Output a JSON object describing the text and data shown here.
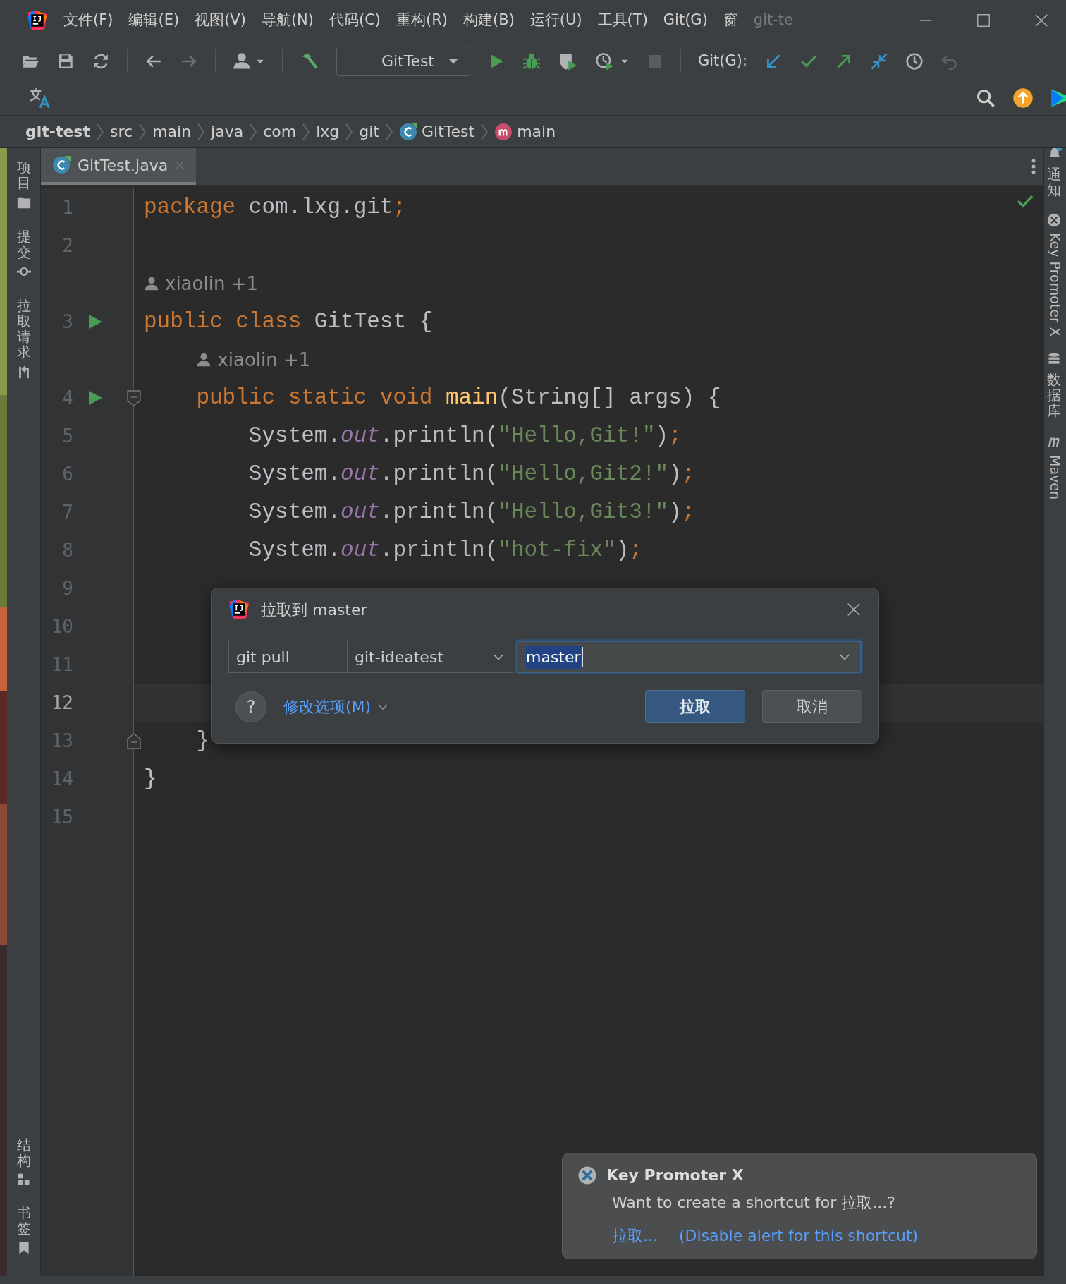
{
  "menu_bar": {
    "items": [
      "文件(F)",
      "编辑(E)",
      "视图(V)",
      "导航(N)",
      "代码(C)",
      "重构(R)",
      "构建(B)",
      "运行(U)",
      "工具(T)",
      "Git(G)",
      "窗"
    ],
    "title": "git-te"
  },
  "toolbar": {
    "run_config": "GitTest",
    "git_label": "Git(G):"
  },
  "breadcrumb": [
    {
      "label": "git-test",
      "kind": "project"
    },
    {
      "label": "src",
      "kind": "folder"
    },
    {
      "label": "main",
      "kind": "folder"
    },
    {
      "label": "java",
      "kind": "folder"
    },
    {
      "label": "com",
      "kind": "folder"
    },
    {
      "label": "lxg",
      "kind": "folder"
    },
    {
      "label": "git",
      "kind": "folder"
    },
    {
      "label": "GitTest",
      "kind": "class"
    },
    {
      "label": "main",
      "kind": "method"
    }
  ],
  "left_tool_windows": [
    {
      "label": "项目",
      "kind": "project"
    },
    {
      "label": "提交",
      "kind": "commit"
    },
    {
      "label": "拉取请求",
      "kind": "pull_request"
    }
  ],
  "left_bottom_tool_windows": [
    {
      "label": "结构",
      "kind": "structure"
    },
    {
      "label": "书签",
      "kind": "bookmarks"
    }
  ],
  "right_tool_windows": [
    {
      "label": "通知",
      "kind": "notifications"
    },
    {
      "label": "Key Promoter X",
      "kind": "key_promoter"
    },
    {
      "label": "数据库",
      "kind": "database"
    },
    {
      "label": "Maven",
      "kind": "maven"
    }
  ],
  "tabs": [
    {
      "label": "GitTest.java",
      "selected": true
    }
  ],
  "editor": {
    "lines": [
      {
        "kind": "code",
        "number": "1",
        "run": false,
        "fold_start": false,
        "fold_end": false,
        "current": false,
        "tokens": [
          {
            "kind": "kw",
            "text": "package"
          },
          {
            "kind": "plain",
            "text": " com.lxg.git"
          },
          {
            "kind": "semi",
            "text": ";"
          }
        ]
      },
      {
        "kind": "code",
        "number": "2",
        "run": false,
        "fold_start": false,
        "fold_end": false,
        "current": false
      },
      {
        "kind": "hint",
        "text": "xiaolin +1"
      },
      {
        "kind": "code",
        "number": "3",
        "run": true,
        "fold_start": false,
        "fold_end": false,
        "current": false,
        "tokens": [
          {
            "kind": "kw",
            "text": "public class"
          },
          {
            "kind": "plain",
            "text": " GitTest {"
          }
        ]
      },
      {
        "kind": "hint",
        "text": "xiaolin +1"
      },
      {
        "kind": "code",
        "number": "4",
        "run": true,
        "fold_start": true,
        "fold_end": false,
        "current": false,
        "tokens": [
          {
            "kind": "kw",
            "text": "    public static void"
          },
          {
            "kind": "fn",
            "text": " main"
          },
          {
            "kind": "plain",
            "text": "(String[] args) {"
          }
        ]
      },
      {
        "kind": "code",
        "number": "5",
        "run": false,
        "fold_start": false,
        "fold_end": false,
        "current": false,
        "tokens": [
          {
            "kind": "plain",
            "text": "        System."
          },
          {
            "kind": "field",
            "text": "out"
          },
          {
            "kind": "plain",
            "text": ".println("
          },
          {
            "kind": "str",
            "text": "\"Hello,Git!\""
          },
          {
            "kind": "plain",
            "text": ")"
          },
          {
            "kind": "semi",
            "text": ";"
          }
        ]
      },
      {
        "kind": "code",
        "number": "6",
        "run": false,
        "fold_start": false,
        "fold_end": false,
        "current": false,
        "tokens": [
          {
            "kind": "plain",
            "text": "        System."
          },
          {
            "kind": "field",
            "text": "out"
          },
          {
            "kind": "plain",
            "text": ".println("
          },
          {
            "kind": "str",
            "text": "\"Hello,Git2!\""
          },
          {
            "kind": "plain",
            "text": ")"
          },
          {
            "kind": "semi",
            "text": ";"
          }
        ]
      },
      {
        "kind": "code",
        "number": "7",
        "run": false,
        "fold_start": false,
        "fold_end": false,
        "current": false,
        "tokens": [
          {
            "kind": "plain",
            "text": "        System."
          },
          {
            "kind": "field",
            "text": "out"
          },
          {
            "kind": "plain",
            "text": ".println("
          },
          {
            "kind": "str",
            "text": "\"Hello,Git3!\""
          },
          {
            "kind": "plain",
            "text": ")"
          },
          {
            "kind": "semi",
            "text": ";"
          }
        ]
      },
      {
        "kind": "code",
        "number": "8",
        "run": false,
        "fold_start": false,
        "fold_end": false,
        "current": false,
        "tokens": [
          {
            "kind": "plain",
            "text": "        System."
          },
          {
            "kind": "field",
            "text": "out"
          },
          {
            "kind": "plain",
            "text": ".println("
          },
          {
            "kind": "str",
            "text": "\"hot-fix\""
          },
          {
            "kind": "plain",
            "text": ")"
          },
          {
            "kind": "semi",
            "text": ";"
          }
        ]
      },
      {
        "kind": "code",
        "number": "9",
        "run": false,
        "fold_start": false,
        "fold_end": false,
        "current": false
      },
      {
        "kind": "code",
        "number": "10",
        "run": false,
        "fold_start": false,
        "fold_end": false,
        "current": false
      },
      {
        "kind": "code",
        "number": "11",
        "run": false,
        "fold_start": false,
        "fold_end": false,
        "current": false
      },
      {
        "kind": "code",
        "number": "12",
        "run": false,
        "fold_start": false,
        "fold_end": false,
        "current": true
      },
      {
        "kind": "code",
        "number": "13",
        "run": false,
        "fold_start": false,
        "fold_end": true,
        "current": false,
        "tokens": [
          {
            "kind": "plain",
            "text": "    }"
          }
        ]
      },
      {
        "kind": "code",
        "number": "14",
        "run": false,
        "fold_start": false,
        "fold_end": false,
        "current": false,
        "tokens": [
          {
            "kind": "plain",
            "text": "}"
          }
        ]
      },
      {
        "kind": "code",
        "number": "15",
        "run": false,
        "fold_start": false,
        "fold_end": false,
        "current": false
      }
    ]
  },
  "dialog": {
    "title": "拉取到 master",
    "command": "git pull",
    "remote": "git-ideatest",
    "branch": "master",
    "help": "?",
    "options_link": "修改选项(M)",
    "buttons": [
      {
        "label": "拉取",
        "primary": true
      },
      {
        "label": "取消",
        "primary": false
      }
    ]
  },
  "notification": {
    "title": "Key Promoter X",
    "message": "Want to create a shortcut for 拉取...?",
    "links": [
      "拉取...",
      "(Disable alert for this shortcut)"
    ]
  }
}
